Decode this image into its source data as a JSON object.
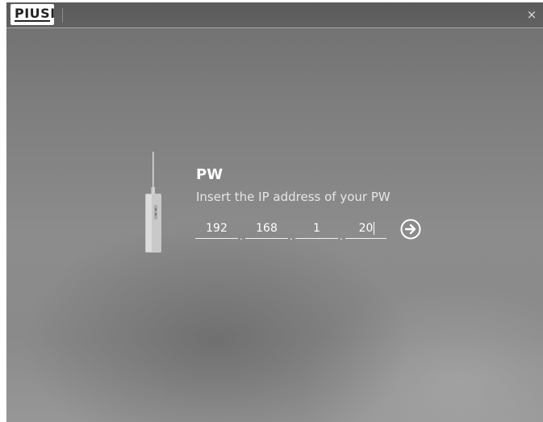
{
  "window": {
    "logo_text": "PIUSI",
    "close_glyph": "×"
  },
  "login": {
    "heading": "PW",
    "subtitle": "Insert the IP address of your PW",
    "ip": {
      "octet1": "192",
      "octet2": "168",
      "octet3": "1",
      "octet4": "20",
      "separator": "."
    }
  },
  "icons": {
    "device": "pw-device-icon",
    "submit": "arrow-right-circle-icon",
    "close": "close-icon"
  }
}
